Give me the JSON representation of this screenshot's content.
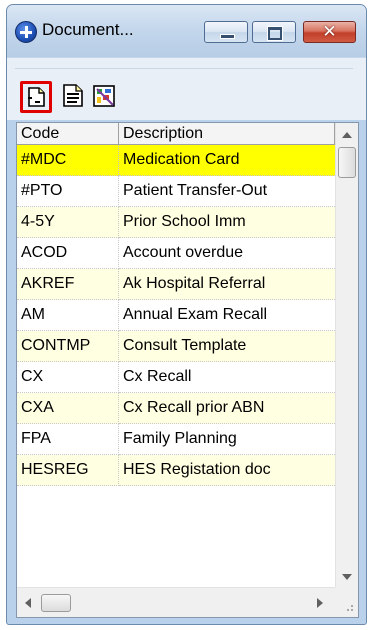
{
  "window": {
    "title": "Document..."
  },
  "toolbar": {
    "buttons": [
      {
        "icon": "new-document-icon"
      },
      {
        "icon": "document-preview-icon"
      },
      {
        "icon": "design-icon"
      }
    ]
  },
  "table": {
    "columns": [
      "Code",
      "Description"
    ],
    "rows": [
      {
        "code": "#MDC",
        "description": "Medication Card"
      },
      {
        "code": "#PTO",
        "description": "Patient Transfer-Out"
      },
      {
        "code": "4-5Y",
        "description": "Prior School Imm"
      },
      {
        "code": "ACOD",
        "description": "Account overdue"
      },
      {
        "code": "AKREF",
        "description": "Ak Hospital Referral"
      },
      {
        "code": "AM",
        "description": "Annual Exam Recall"
      },
      {
        "code": "CONTMP",
        "description": "Consult Template"
      },
      {
        "code": "CX",
        "description": "Cx Recall"
      },
      {
        "code": "CXA",
        "description": "Cx Recall prior ABN"
      },
      {
        "code": "FPA",
        "description": "Family Planning"
      },
      {
        "code": "HESREG",
        "description": "HES Registation doc"
      }
    ],
    "selected_row": 0
  },
  "colors": {
    "selected_row": "#ffff00",
    "alt_row": "#ffffe1",
    "row": "#ffffff",
    "highlight_border": "#e00000"
  }
}
